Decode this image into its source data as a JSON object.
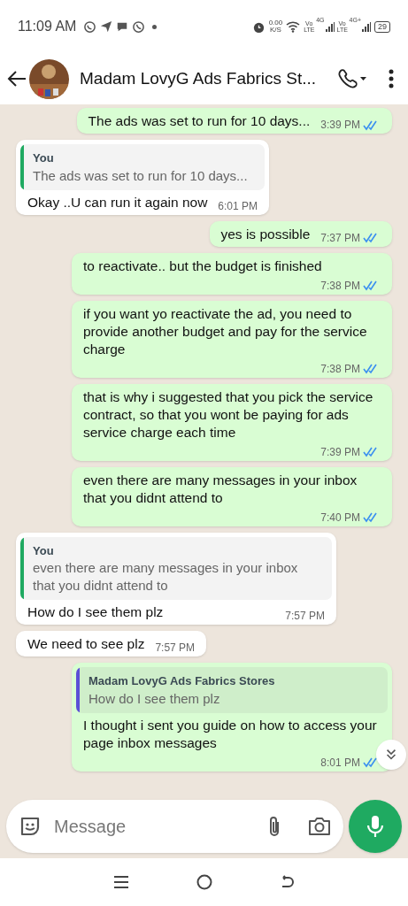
{
  "status_bar": {
    "time": "11:09 AM",
    "net_speed": "0.00",
    "net_unit": "K/S",
    "sim_1": {
      "volte": "Vo LTE",
      "network": "4G"
    },
    "sim_2": {
      "volte": "Vo LTE",
      "network": "4G+"
    },
    "battery": "29"
  },
  "header": {
    "title": "Madam LovyG Ads Fabrics St..."
  },
  "messages": [
    {
      "kind": "out",
      "text": "The ads was set to run for 10 days...",
      "time": "3:39 PM",
      "read": true
    },
    {
      "kind": "in",
      "quote": {
        "author": "You",
        "text": "The ads was set to run for 10 days...",
        "color": "#1faa61"
      },
      "text": "Okay ..U can run it again now",
      "time": "6:01 PM"
    },
    {
      "kind": "out",
      "text": "yes is possible",
      "time": "7:37 PM",
      "read": true
    },
    {
      "kind": "out",
      "text": "to reactivate.. but the budget is finished",
      "time": "7:38 PM",
      "read": true
    },
    {
      "kind": "out",
      "text": "if you want yo reactivate the ad, you need to provide another budget and pay for the service charge",
      "time": "7:38 PM",
      "read": true
    },
    {
      "kind": "out",
      "text": "that is why i suggested that you pick the service contract, so that you wont be paying for ads service charge each time",
      "time": "7:39 PM",
      "read": true
    },
    {
      "kind": "out",
      "text": "even there are many messages in your inbox that you didnt attend to",
      "time": "7:40 PM",
      "read": true
    },
    {
      "kind": "in",
      "quote": {
        "author": "You",
        "text": "even there are many messages in your inbox that you didnt attend to",
        "color": "#1faa61"
      },
      "text": "How do I see them plz",
      "time": "7:57 PM"
    },
    {
      "kind": "in",
      "text": "We need to see plz",
      "time": "7:57 PM"
    },
    {
      "kind": "out",
      "quote": {
        "author": "Madam LovyG Ads Fabrics Stores",
        "text": "How do I see them plz",
        "color": "#5b50d6"
      },
      "text": "I thought i sent you guide on how to access your page inbox messages",
      "time": "8:01 PM",
      "read": true
    }
  ],
  "composer": {
    "placeholder": "Message"
  }
}
